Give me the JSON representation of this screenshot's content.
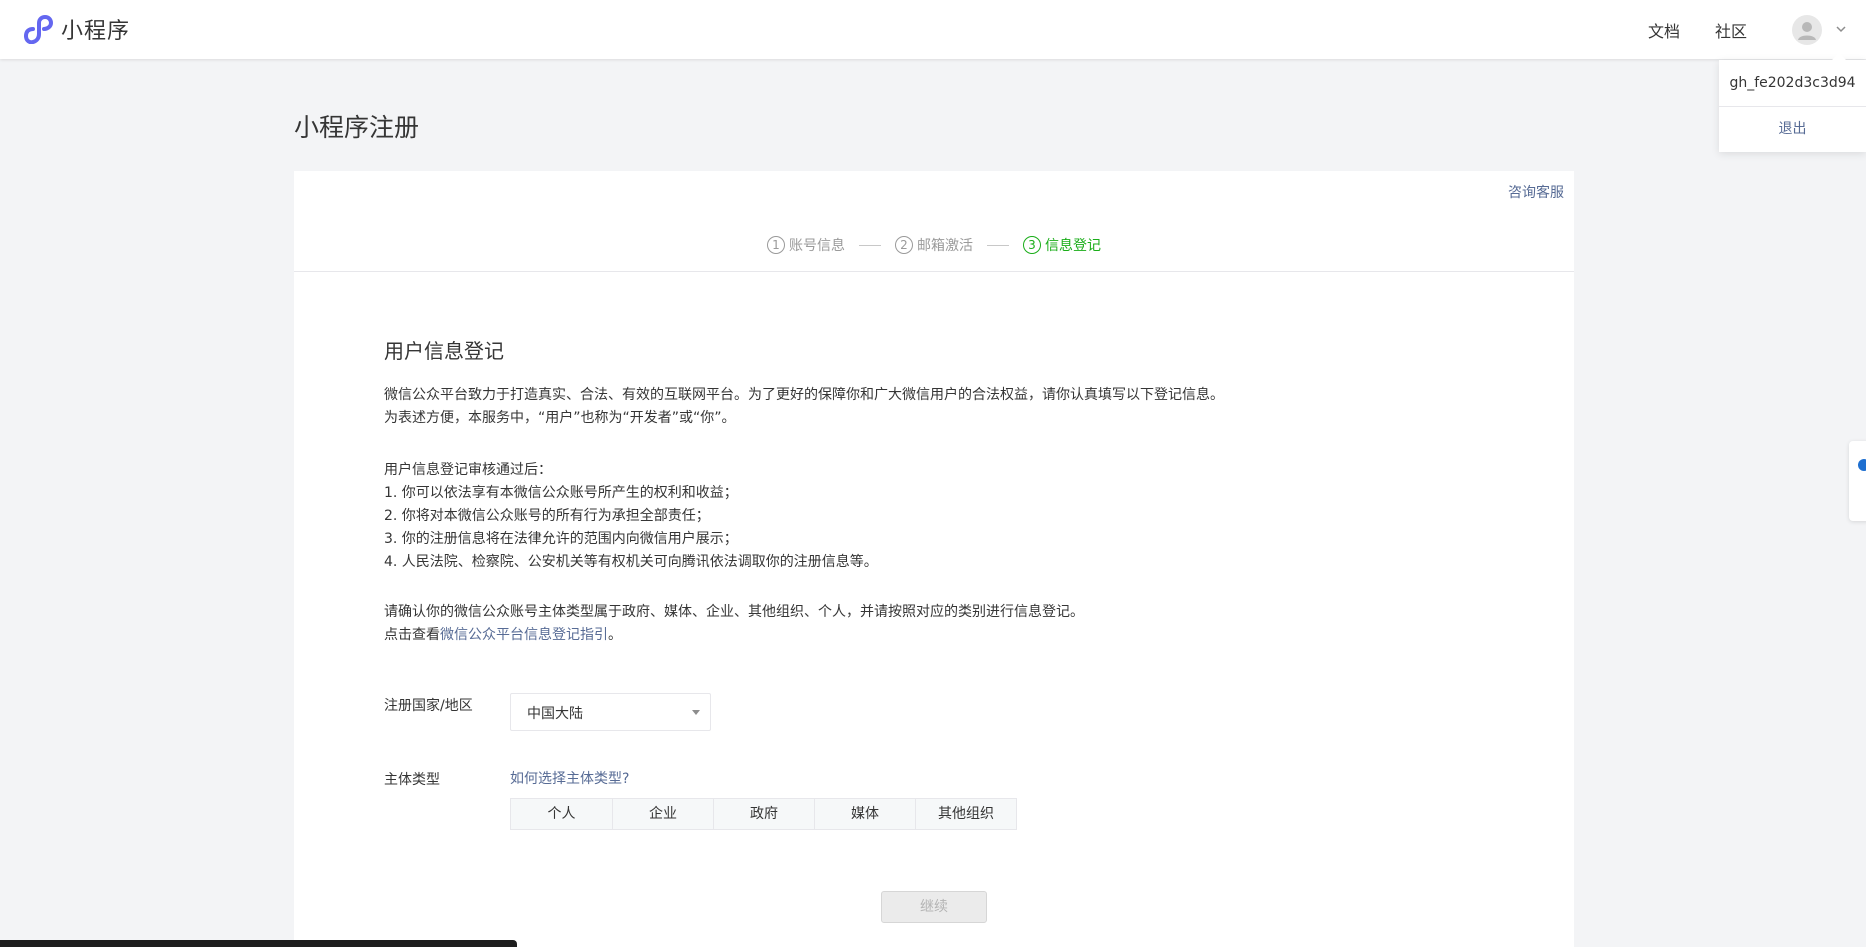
{
  "header": {
    "logo_text": "小程序",
    "nav_docs": "文档",
    "nav_community": "社区"
  },
  "account_menu": {
    "account_id": "gh_fe202d3c3d94",
    "logout": "退出"
  },
  "page": {
    "title": "小程序注册",
    "consult": "咨询客服"
  },
  "steps": [
    {
      "num": "1",
      "label": "账号信息",
      "state": "done"
    },
    {
      "num": "2",
      "label": "邮箱激活",
      "state": "done"
    },
    {
      "num": "3",
      "label": "信息登记",
      "state": "active"
    }
  ],
  "content": {
    "section_title": "用户信息登记",
    "intro_line1": "微信公众平台致力于打造真实、合法、有效的互联网平台。为了更好的保障你和广大微信用户的合法权益，请你认真填写以下登记信息。",
    "intro_line2": "为表述方便，本服务中，“用户”也称为“开发者”或“你”。",
    "after_title": "用户信息登记审核通过后：",
    "after_items": [
      "1. 你可以依法享有本微信公众账号所产生的权利和收益；",
      "2. 你将对本微信公众账号的所有行为承担全部责任；",
      "3. 你的注册信息将在法律允许的范围内向微信用户展示；",
      "4. 人民法院、检察院、公安机关等有权机关可向腾讯依法调取你的注册信息等。"
    ],
    "confirm_line": "请确认你的微信公众账号主体类型属于政府、媒体、企业、其他组织、个人，并请按照对应的类别进行信息登记。",
    "guide_prefix": "点击查看",
    "guide_link": "微信公众平台信息登记指引",
    "guide_suffix": "。"
  },
  "form": {
    "country_label": "注册国家/地区",
    "country_value": "中国大陆",
    "type_label": "主体类型",
    "type_help": "如何选择主体类型?",
    "type_options": [
      "个人",
      "企业",
      "政府",
      "媒体",
      "其他组织"
    ],
    "continue": "继续"
  },
  "colors": {
    "link": "#576b95",
    "active_step": "#1aad19",
    "brand_logo": "#6467f0"
  }
}
